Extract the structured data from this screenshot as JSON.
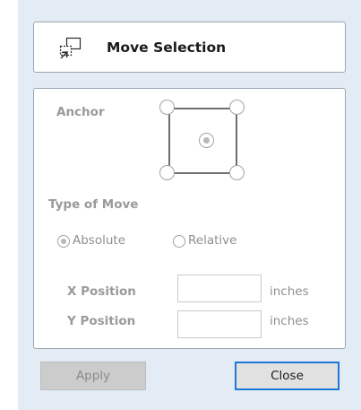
{
  "header": {
    "title": "Move Selection",
    "icon": "move-selection-icon"
  },
  "anchor": {
    "label": "Anchor",
    "selected": "center"
  },
  "move_type": {
    "label": "Type of Move",
    "options": [
      {
        "label": "Absolute",
        "checked": true
      },
      {
        "label": "Relative",
        "checked": false
      }
    ]
  },
  "position": {
    "x_label": "X Position",
    "x_value": "",
    "x_unit": "inches",
    "y_label": "Y Position",
    "y_value": "",
    "y_unit": "inches"
  },
  "buttons": {
    "apply": "Apply",
    "close": "Close"
  },
  "colors": {
    "panel_bg": "#e3ebf4",
    "focus_border": "#1e78d7",
    "disabled_text": "#9a9a9a"
  }
}
